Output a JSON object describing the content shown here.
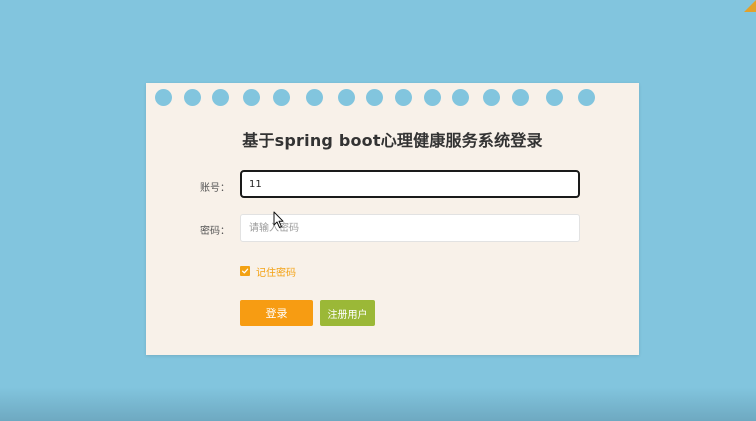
{
  "page": {
    "title": "基于spring boot心理健康服务系统登录"
  },
  "form": {
    "account_label": "账号：",
    "account_value": "11",
    "password_label": "密码：",
    "password_placeholder": "请输入密码",
    "remember_label": "记住密码",
    "remember_checked": true
  },
  "buttons": {
    "login_label": "登录",
    "register_label": "注册用户"
  },
  "colors": {
    "background": "#82c5de",
    "card": "#f8f1e9",
    "accent_orange": "#f79c12",
    "accent_green": "#9bb837"
  }
}
